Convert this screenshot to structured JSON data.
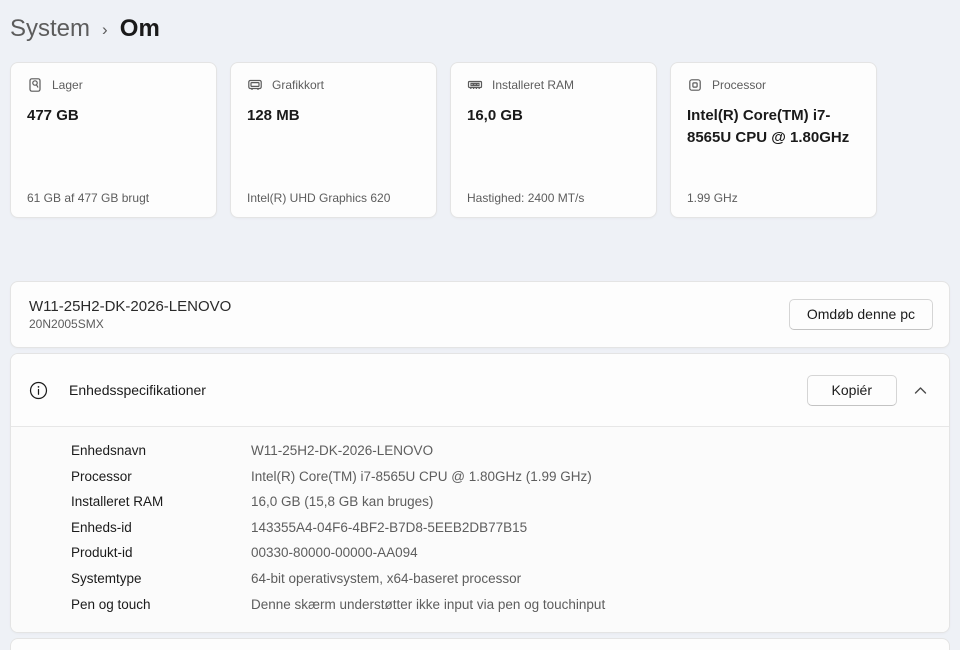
{
  "breadcrumb": {
    "parent": "System",
    "separator": "›",
    "current": "Om"
  },
  "cards": [
    {
      "icon": "storage-icon",
      "label": "Lager",
      "value": "477 GB",
      "footer": "61 GB af 477 GB brugt"
    },
    {
      "icon": "gpu-icon",
      "label": "Grafikkort",
      "value": "128 MB",
      "footer": "Intel(R) UHD Graphics 620"
    },
    {
      "icon": "ram-icon",
      "label": "Installeret RAM",
      "value": "16,0 GB",
      "footer": "Hastighed: 2400 MT/s"
    },
    {
      "icon": "cpu-icon",
      "label": "Processor",
      "value": "Intel(R) Core(TM) i7-8565U CPU @ 1.80GHz",
      "footer": "1.99 GHz"
    }
  ],
  "device": {
    "name": "W11-25H2-DK-2026-LENOVO",
    "model": "20N2005SMX",
    "rename_button": "Omdøb denne pc"
  },
  "specs": {
    "title": "Enhedsspecifikationer",
    "copy_button": "Kopiér",
    "expanded": true,
    "rows": [
      {
        "label": "Enhedsnavn",
        "value": "W11-25H2-DK-2026-LENOVO"
      },
      {
        "label": "Processor",
        "value": "Intel(R) Core(TM) i7-8565U CPU @ 1.80GHz (1.99 GHz)"
      },
      {
        "label": "Installeret RAM",
        "value": "16,0 GB (15,8 GB kan bruges)"
      },
      {
        "label": "Enheds-id",
        "value": "143355A4-04F6-4BF2-B7D8-5EEB2DB77B15"
      },
      {
        "label": "Produkt-id",
        "value": "00330-80000-00000-AA094"
      },
      {
        "label": "Systemtype",
        "value": "64-bit operativsystem, x64-baseret processor"
      },
      {
        "label": "Pen og touch",
        "value": "Denne skærm understøtter ikke input via pen og touchinput"
      }
    ]
  },
  "colors": {
    "page_background": "#eef1f6",
    "card_background": "#fdfdfd",
    "border": "#e4e4e4",
    "text_primary": "#1b1b1b",
    "text_secondary": "#5d5d5d"
  }
}
